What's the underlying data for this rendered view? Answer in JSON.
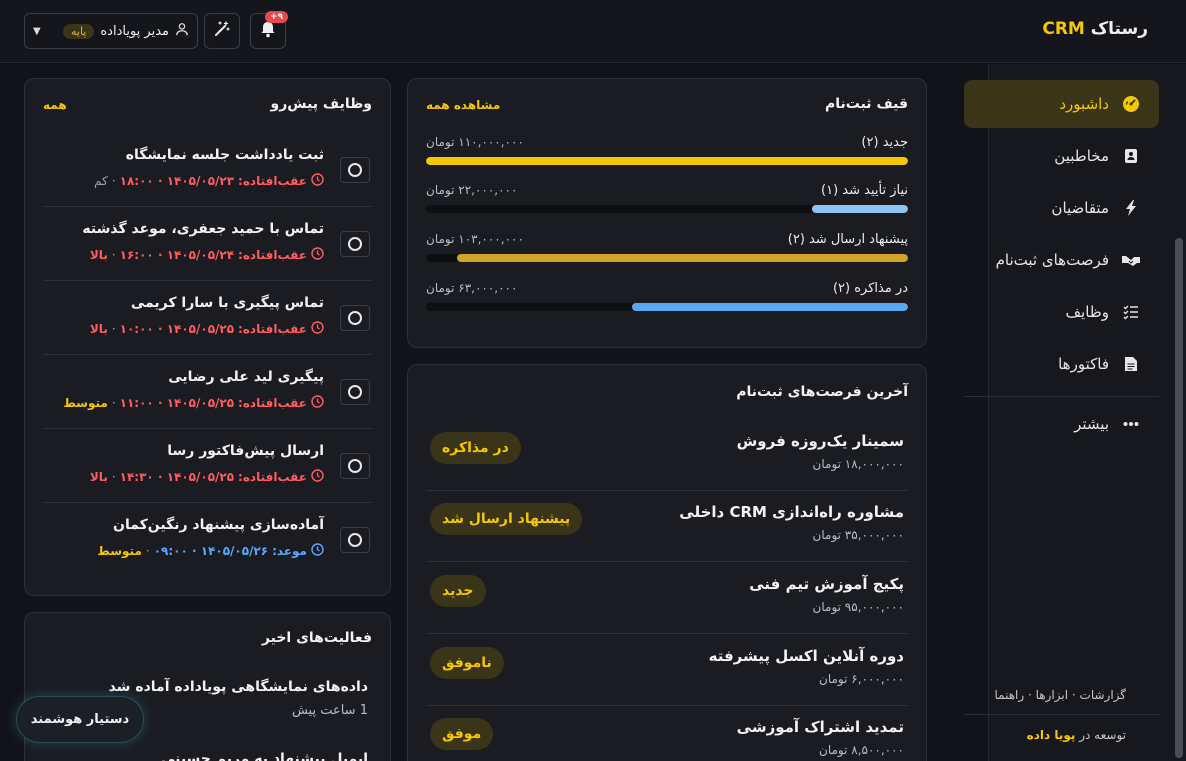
{
  "header": {
    "brand_prefix": "رستاک",
    "brand_accent": "CRM",
    "user_name": "مدیر پویاداده",
    "user_plan": "پایه",
    "notif_count": "+۹"
  },
  "sidebar": {
    "items": [
      {
        "label": "داشبورد",
        "icon": "dashboard-icon"
      },
      {
        "label": "مخاطبین",
        "icon": "contacts-icon"
      },
      {
        "label": "متقاضیان",
        "icon": "bolt-icon"
      },
      {
        "label": "فرصت‌های ثبت‌نام",
        "icon": "handshake-icon"
      },
      {
        "label": "وظایف",
        "icon": "tasks-icon"
      },
      {
        "label": "فاکتورها",
        "icon": "invoice-icon"
      }
    ],
    "more_label": "بیشتر",
    "footer_links": [
      "گزارشات",
      "ابزارها",
      "راهنما"
    ],
    "footer_dev_prefix": "توسعه در",
    "footer_dev_name": "پویا داده"
  },
  "funnel": {
    "title": "قیف ثبت‌نام",
    "link": "مشاهده همه",
    "rows": [
      {
        "label": "جدید (۲)",
        "amount": "۱۱۰,۰۰۰,۰۰۰ تومان",
        "fraction": 1.0,
        "color": "#f5c800"
      },
      {
        "label": "نیاز تأیید شد (۱)",
        "amount": "۲۲,۰۰۰,۰۰۰ تومان",
        "fraction": 0.2,
        "color": "#8fc3f2"
      },
      {
        "label": "پیشنهاد ارسال شد (۲)",
        "amount": "۱۰۳,۰۰۰,۰۰۰ تومان",
        "fraction": 0.936,
        "color": "#cfa52a"
      },
      {
        "label": "در مذاکره (۲)",
        "amount": "۶۳,۰۰۰,۰۰۰ تومان",
        "fraction": 0.573,
        "color": "#5aa9ef"
      }
    ]
  },
  "deals": {
    "title": "آخرین فرصت‌های ثبت‌نام",
    "items": [
      {
        "name": "سمینار یک‌روزه فروش",
        "value": "۱۸,۰۰۰,۰۰۰ تومان",
        "status": "در مذاکره"
      },
      {
        "name": "مشاوره راه‌اندازی CRM داخلی",
        "value": "۳۵,۰۰۰,۰۰۰ تومان",
        "status": "پیشنهاد ارسال شد"
      },
      {
        "name": "پکیج آموزش تیم فنی",
        "value": "۹۵,۰۰۰,۰۰۰ تومان",
        "status": "جدید"
      },
      {
        "name": "دوره آنلاین اکسل پیشرفته",
        "value": "۶,۰۰۰,۰۰۰ تومان",
        "status": "ناموفق"
      },
      {
        "name": "تمدید اشتراک آموزشی",
        "value": "۸,۵۰۰,۰۰۰ تومان",
        "status": "موفق"
      }
    ]
  },
  "tasks": {
    "title": "وظایف پیش‌رو",
    "link": "همه",
    "items": [
      {
        "title": "ثبت یادداشت جلسه نمایشگاه",
        "state": "عقب‌افتاده:",
        "date": "۱۴۰۵/۰۵/۲۳ · ۱۸:۰۰",
        "priority": "کم",
        "state_kind": "late",
        "priority_kind": "low"
      },
      {
        "title": "تماس با حمید جعفری، موعد گذشته",
        "state": "عقب‌افتاده:",
        "date": "۱۴۰۵/۰۵/۲۴ · ۱۶:۰۰",
        "priority": "بالا",
        "state_kind": "late",
        "priority_kind": "high"
      },
      {
        "title": "تماس پیگیری با سارا کریمی",
        "state": "عقب‌افتاده:",
        "date": "۱۴۰۵/۰۵/۲۵ · ۱۰:۰۰",
        "priority": "بالا",
        "state_kind": "late",
        "priority_kind": "high"
      },
      {
        "title": "پیگیری لید علی رضایی",
        "state": "عقب‌افتاده:",
        "date": "۱۴۰۵/۰۵/۲۵ · ۱۱:۰۰",
        "priority": "متوسط",
        "state_kind": "late",
        "priority_kind": "mid"
      },
      {
        "title": "ارسال پیش‌فاکتور رسا",
        "state": "عقب‌افتاده:",
        "date": "۱۴۰۵/۰۵/۲۵ · ۱۴:۳۰",
        "priority": "بالا",
        "state_kind": "late",
        "priority_kind": "high"
      },
      {
        "title": "آماده‌سازی پیشنهاد رنگین‌کمان",
        "state": "موعد:",
        "date": "۱۴۰۵/۰۵/۲۶ · ۰۹:۰۰",
        "priority": "متوسط",
        "state_kind": "due",
        "priority_kind": "mid"
      }
    ]
  },
  "activities": {
    "title": "فعالیت‌های اخیر",
    "items": [
      {
        "text": "داده‌های نمایشگاهی پویاداده آماده شد",
        "time": "1 ساعت پیش"
      },
      {
        "text": "ایمیل پیشنهاد به مریم حسینی",
        "time": ""
      }
    ]
  },
  "assistant_label": "دستیار هوشمند"
}
